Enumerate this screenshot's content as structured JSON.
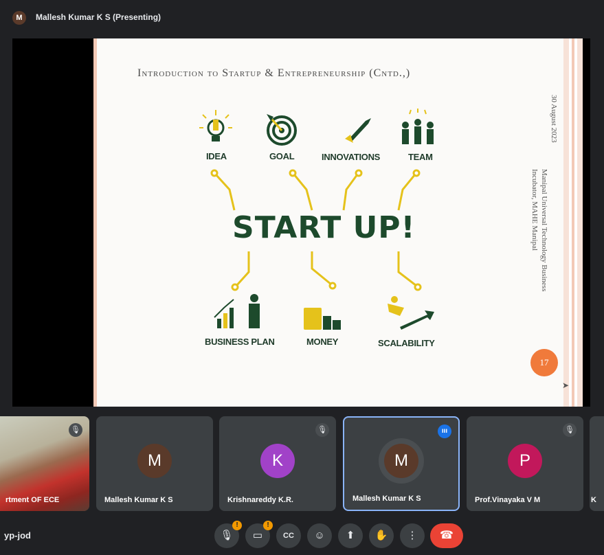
{
  "header": {
    "presenter_initial": "M",
    "presenter_label": "Mallesh Kumar K S (Presenting)"
  },
  "slide": {
    "title": "Introduction to Startup & Entrepreneurship (Cntd.,)",
    "side_date": "30 August 2023",
    "side_org_line1": "Manipal Universal Technology Business",
    "side_org_line2": "Incubator, MAHE Manipal",
    "center_text": "START UP!",
    "labels": {
      "idea": "IDEA",
      "goal": "GOAL",
      "innovations": "INNOVATIONS",
      "team": "TEAM",
      "business_plan": "BUSINESS PLAN",
      "money": "MONEY",
      "scalability": "SCALABILITY"
    },
    "page_number": "17",
    "colors": {
      "green": "#1d4a2c",
      "yellow": "#e5c21b",
      "orange": "#f07a3b"
    }
  },
  "participants": [
    {
      "name": "rtment OF ECE",
      "type": "video",
      "muted": true
    },
    {
      "name": "Mallesh Kumar K S",
      "initial": "M",
      "color": "#5a3a2a"
    },
    {
      "name": "Krishnareddy K.R.",
      "initial": "K",
      "color": "#a142c8",
      "muted": true
    },
    {
      "name": "Mallesh Kumar K S",
      "initial": "M",
      "color": "#5a3a2a",
      "speaking": true
    },
    {
      "name": "Prof.Vinayaka V M",
      "initial": "P",
      "color": "#c2185b",
      "muted": true
    },
    {
      "name": "K"
    }
  ],
  "footer": {
    "meeting_code": "yp-jod",
    "icons": [
      "mic-off-icon",
      "camera-off-icon",
      "captions-icon",
      "emoji-icon",
      "present-icon",
      "raise-hand-icon",
      "more-icon",
      "end-call-icon"
    ],
    "captions_label": "CC"
  }
}
